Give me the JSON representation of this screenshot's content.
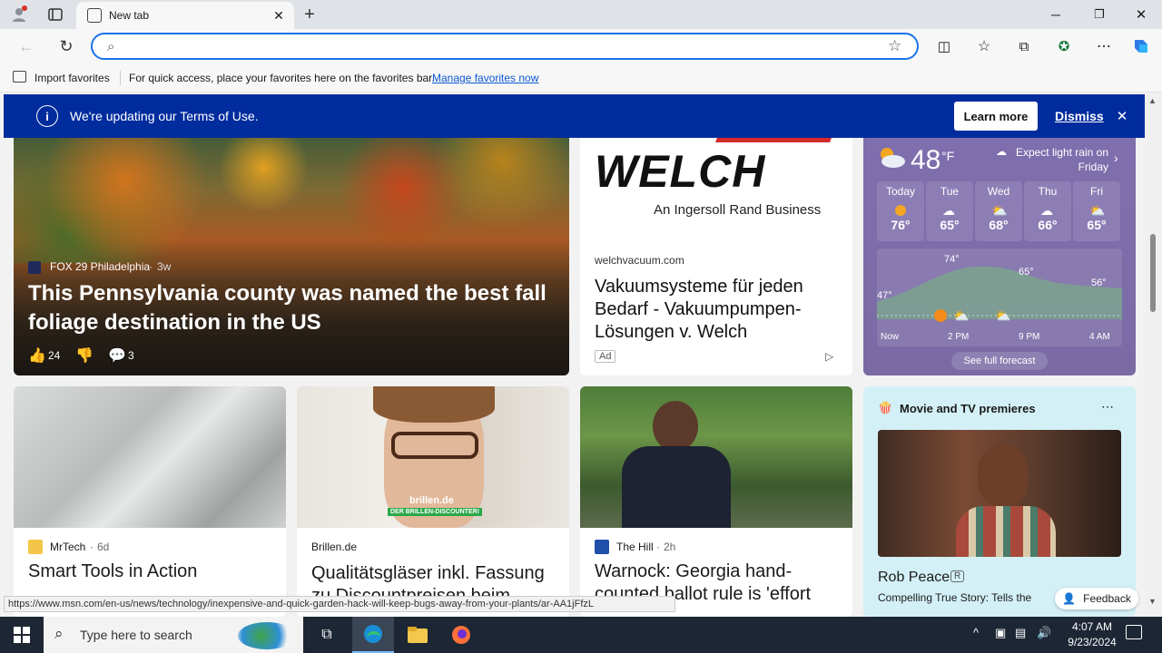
{
  "browser": {
    "tab_title": "New tab",
    "address_value": "",
    "import_favorites": "Import favorites",
    "favbar_message": "For quick access, place your favorites here on the favorites bar.",
    "manage_favorites": "Manage favorites now"
  },
  "banner": {
    "message": "We're updating our Terms of Use.",
    "learn_more": "Learn more",
    "dismiss": "Dismiss"
  },
  "hero": {
    "source": "FOX 29 Philadelphia",
    "age": "3w",
    "title": "This Pennsylvania county was named the best fall foliage destination in the US",
    "likes": "24",
    "comments": "3"
  },
  "ad": {
    "brand": "WELCH",
    "tagline": "An Ingersoll Rand Business",
    "domain": "welchvacuum.com",
    "title": "Vakuumsysteme für jeden Bedarf - Vakuumpumpen-Lösungen v. Welch",
    "ad_label": "Ad"
  },
  "weather": {
    "temp": "48",
    "unit": "°F",
    "forecast_note": "Expect light rain on Friday",
    "days": [
      {
        "day": "Today",
        "temp": "76°"
      },
      {
        "day": "Tue",
        "temp": "65°"
      },
      {
        "day": "Wed",
        "temp": "68°"
      },
      {
        "day": "Thu",
        "temp": "66°"
      },
      {
        "day": "Fri",
        "temp": "65°"
      }
    ],
    "chart_labels": {
      "t1": "47°",
      "t2": "74°",
      "t3": "65°",
      "t4": "56°"
    },
    "time_labels": [
      "Now",
      "2 PM",
      "9 PM",
      "4 AM"
    ],
    "see_full": "See full forecast"
  },
  "cards": [
    {
      "source": "MrTech",
      "age": "6d",
      "title": "Smart Tools in Action"
    },
    {
      "source": "Brillen.de",
      "age": "",
      "title": "Qualitätsgläser inkl. Fassung zu Discountpreisen beim",
      "image_badge": "brillen.de",
      "image_badge_sub": "DER BRILLEN-DISCOUNTER!"
    },
    {
      "source": "The Hill",
      "age": "2h",
      "title": "Warnock: Georgia hand-counted ballot rule is 'effort"
    }
  ],
  "movies": {
    "header": "Movie and TV premieres",
    "title": "Rob Peace",
    "rating": "R",
    "desc": "Compelling True Story: Tells the",
    "feedback": "Feedback"
  },
  "status_url": "https://www.msn.com/en-us/news/technology/inexpensive-and-quick-garden-hack-will-keep-bugs-away-from-your-plants/ar-AA1jFfzL",
  "taskbar": {
    "search_placeholder": "Type here to search",
    "time": "4:07 AM",
    "date": "9/23/2024"
  },
  "colors": {
    "accent": "#1a73e8",
    "banner": "#002c9e",
    "weather": "#7b6aa6"
  }
}
